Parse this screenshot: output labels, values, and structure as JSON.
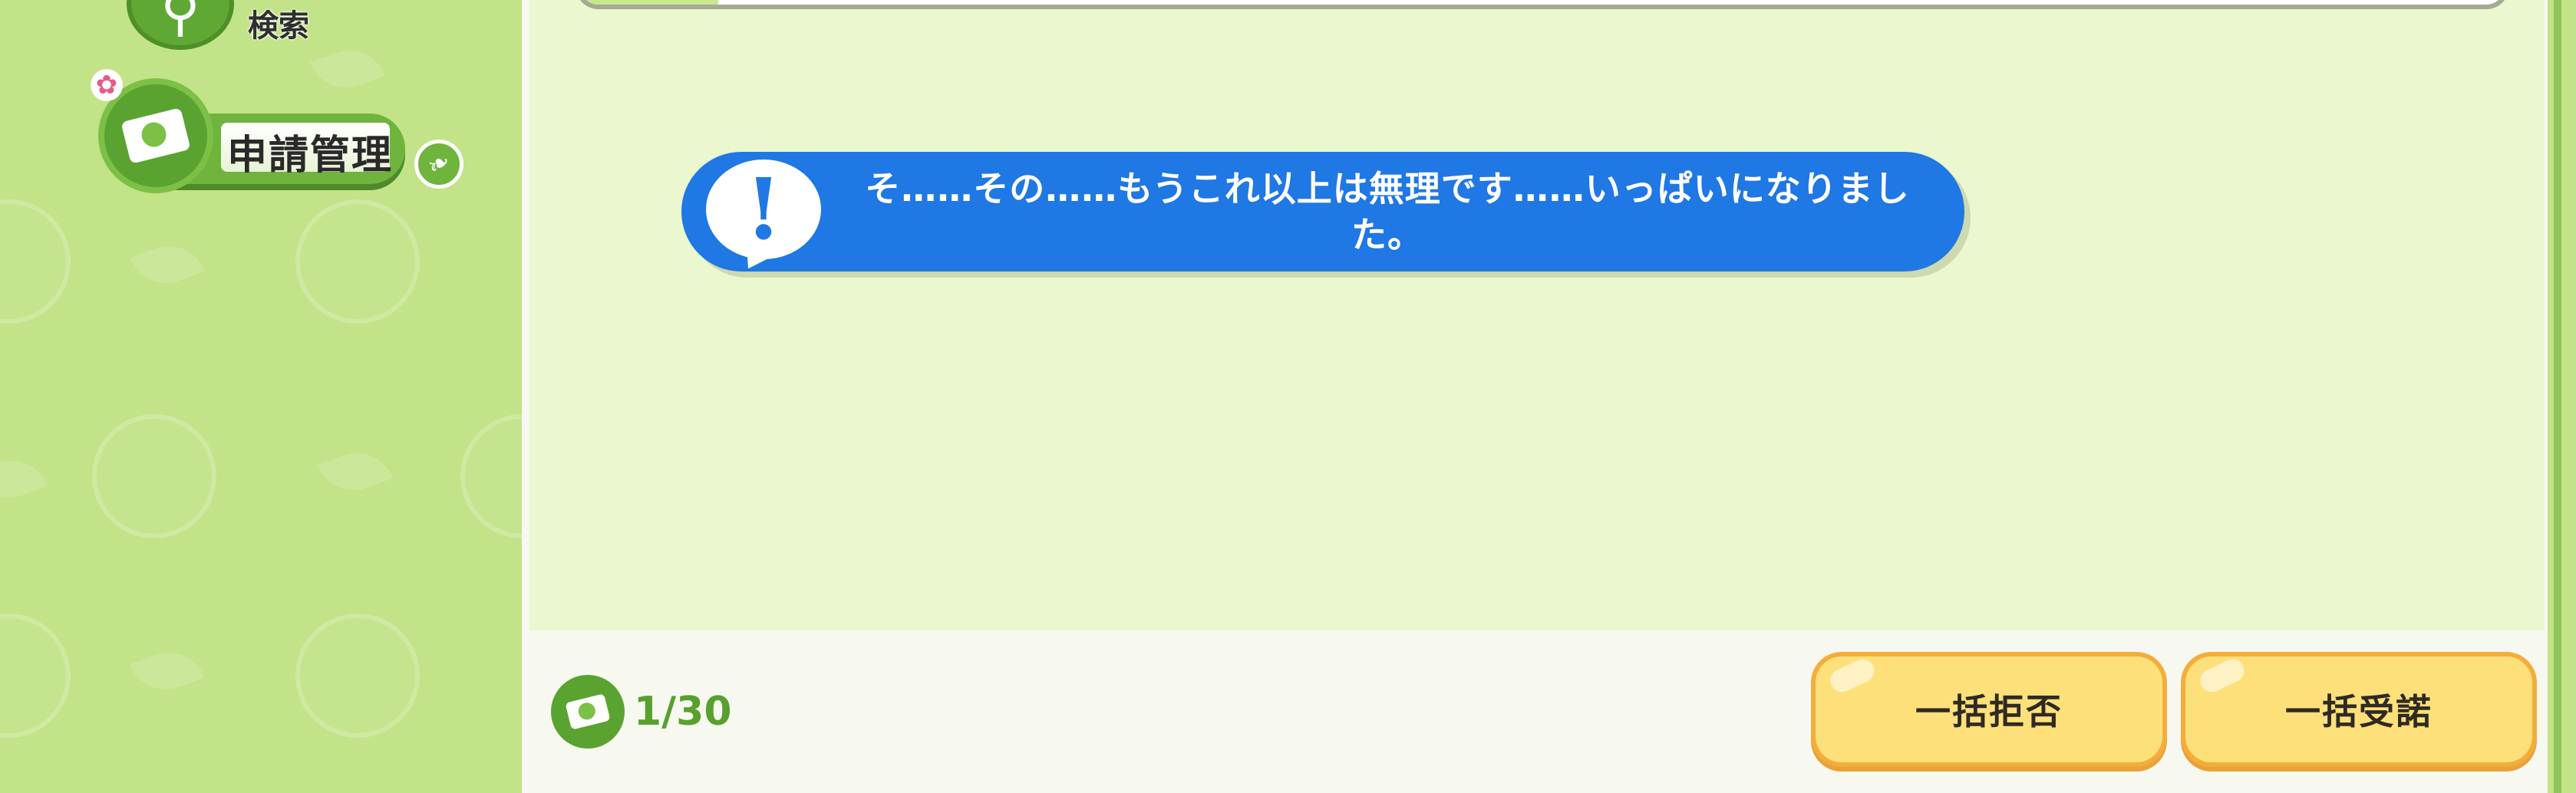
{
  "sidebar": {
    "items": [
      {
        "label": "検索",
        "icon": "search-icon"
      },
      {
        "label": "申請管理",
        "icon": "envelope-icon",
        "badge_icon": "flower-badge-icon",
        "tip_icon": "leaf-icon"
      }
    ]
  },
  "notice": {
    "icon": "exclamation-bubble-icon",
    "text": "そ……その……もうこれ以上は無理です……いっぱいになりました。"
  },
  "footer": {
    "counter_icon": "envelope-icon",
    "counter": "1/30",
    "reject_all_label": "一括拒否",
    "accept_all_label": "一括受諾"
  },
  "colors": {
    "sidebar_bg": "#c2e387",
    "content_bg": "#eaf7cf",
    "notice_bg": "#1f78e3",
    "button_bg": "#fde07a",
    "button_border": "#f4ad3c",
    "accent_green": "#58a02f"
  }
}
